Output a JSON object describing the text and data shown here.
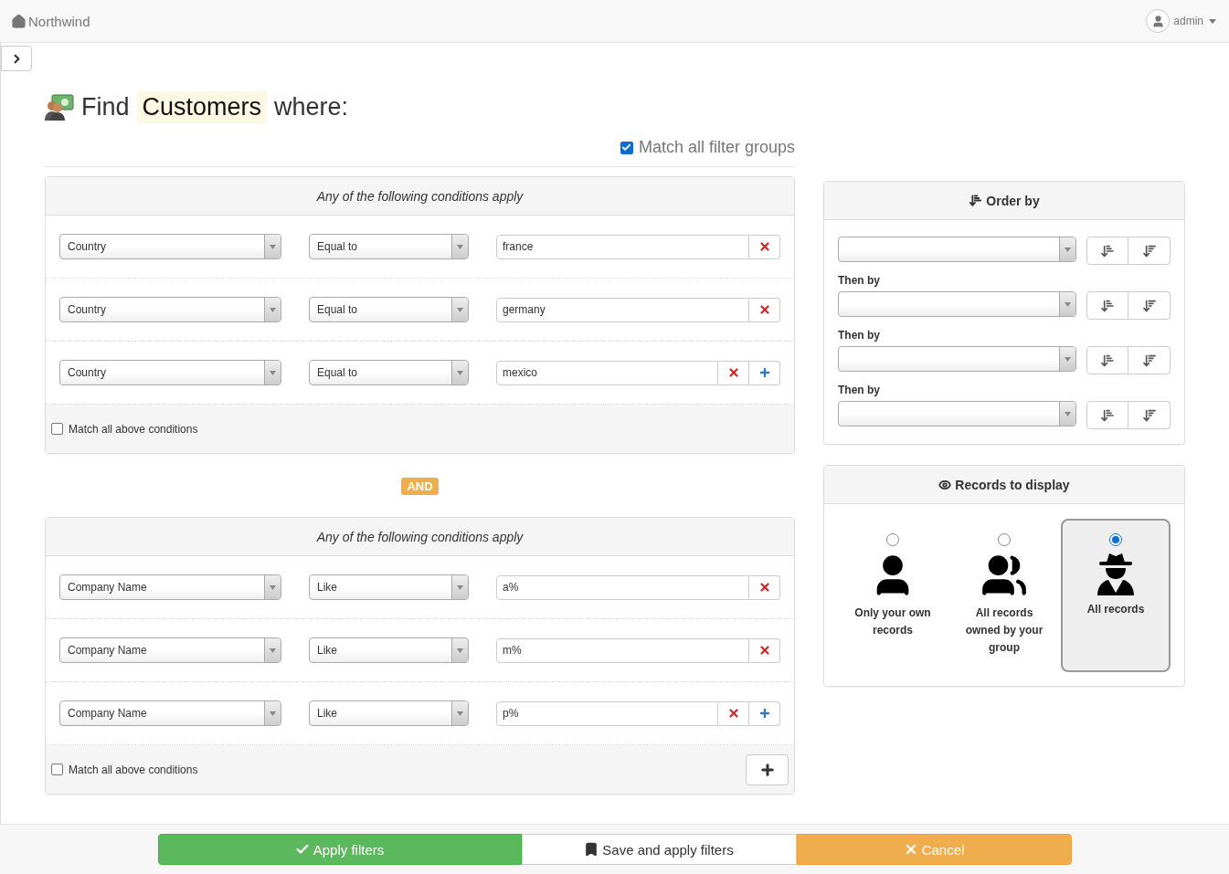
{
  "navbar": {
    "brand": "Northwind",
    "user": "admin"
  },
  "title": {
    "prefix": "Find",
    "entity": "Customers",
    "suffix": "where:"
  },
  "match_all_groups": {
    "label": "Match all filter groups",
    "checked": true
  },
  "groups": [
    {
      "header": "Any of the following conditions apply",
      "conditions": [
        {
          "field": "Country",
          "operator": "Equal to",
          "value": "france",
          "can_add": false
        },
        {
          "field": "Country",
          "operator": "Equal to",
          "value": "germany",
          "can_add": false
        },
        {
          "field": "Country",
          "operator": "Equal to",
          "value": "mexico",
          "can_add": true
        }
      ],
      "match_all": {
        "label": "Match all above conditions",
        "checked": false
      },
      "can_add_group": false
    },
    {
      "header": "Any of the following conditions apply",
      "conditions": [
        {
          "field": "Company Name",
          "operator": "Like",
          "value": "a%",
          "can_add": false
        },
        {
          "field": "Company Name",
          "operator": "Like",
          "value": "m%",
          "can_add": false
        },
        {
          "field": "Company Name",
          "operator": "Like",
          "value": "p%",
          "can_add": true
        }
      ],
      "match_all": {
        "label": "Match all above conditions",
        "checked": false
      },
      "can_add_group": true
    }
  ],
  "connector": "AND",
  "order_by": {
    "title": "Order by",
    "rows": [
      {
        "label": null
      },
      {
        "label": "Then by"
      },
      {
        "label": "Then by"
      },
      {
        "label": "Then by"
      }
    ]
  },
  "records": {
    "title": "Records to display",
    "options": [
      {
        "kind": "own",
        "label": "Only your own records",
        "selected": false
      },
      {
        "kind": "group",
        "label": "All records owned by your group",
        "selected": false
      },
      {
        "kind": "all",
        "label": "All records",
        "selected": true
      }
    ]
  },
  "footer_buttons": [
    {
      "kind": "apply",
      "label": "Apply filters"
    },
    {
      "kind": "save",
      "label": "Save and apply filters"
    },
    {
      "kind": "cancel",
      "label": "Cancel"
    }
  ]
}
